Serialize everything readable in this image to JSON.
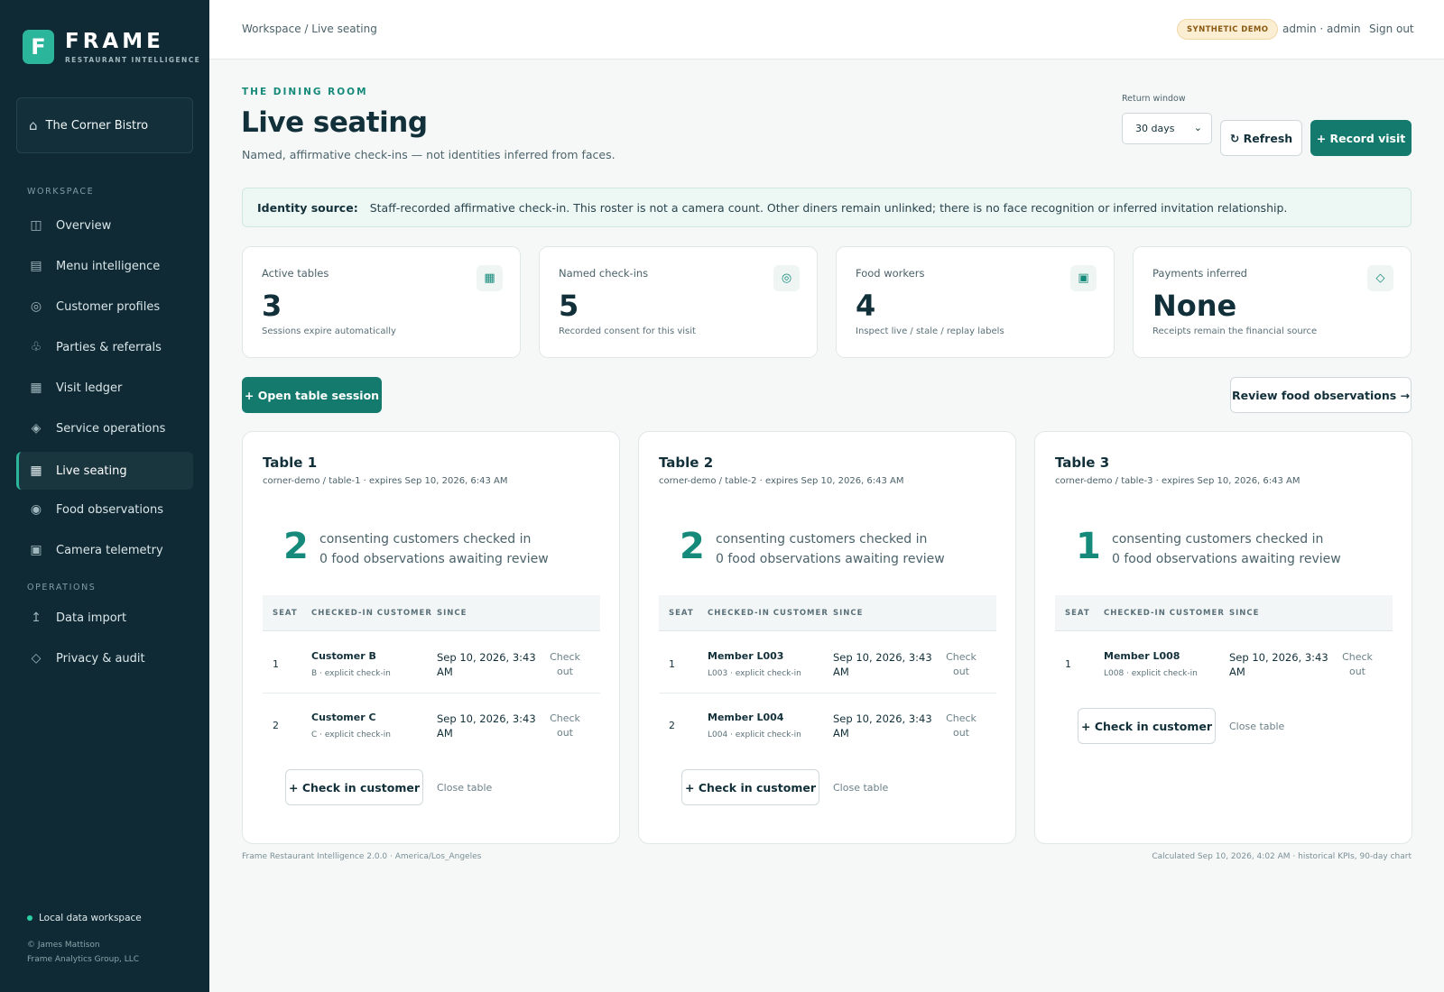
{
  "brand": {
    "mark": "F",
    "name": "FRAME",
    "sub": "RESTAURANT INTELLIGENCE"
  },
  "venue": {
    "icon": "home-icon",
    "name": "The Corner Bistro"
  },
  "nav": {
    "workspace_label": "WORKSPACE",
    "operations_label": "OPERATIONS",
    "items": [
      {
        "label": "Overview",
        "icon": "grid-icon"
      },
      {
        "label": "Menu intelligence",
        "icon": "menu-icon"
      },
      {
        "label": "Customer profiles",
        "icon": "target-icon"
      },
      {
        "label": "Parties & referrals",
        "icon": "club-icon"
      },
      {
        "label": "Visit ledger",
        "icon": "ledger-icon"
      },
      {
        "label": "Service operations",
        "icon": "diamond-icon"
      },
      {
        "label": "Live seating",
        "icon": "seating-icon",
        "active": true
      },
      {
        "label": "Food observations",
        "icon": "eye-icon"
      },
      {
        "label": "Camera telemetry",
        "icon": "camera-icon"
      }
    ],
    "ops_items": [
      {
        "label": "Data import",
        "icon": "upload-icon"
      },
      {
        "label": "Privacy & audit",
        "icon": "shield-icon"
      }
    ]
  },
  "sidebar_footer": {
    "status": "Local data workspace",
    "copyright_line1": "© James Mattison",
    "copyright_line2": "Frame Analytics Group, LLC"
  },
  "topbar": {
    "breadcrumb": "Workspace / Live seating",
    "badge": "SYNTHETIC DEMO",
    "user": "admin · admin",
    "signout": "Sign out"
  },
  "header": {
    "eyebrow": "THE DINING ROOM",
    "title": "Live seating",
    "subtitle": "Named, affirmative check-ins — not identities inferred from faces.",
    "return_window_label": "Return window",
    "return_window_value": "30 days",
    "refresh_label": "↻ Refresh",
    "record_label": "+ Record visit"
  },
  "identity": {
    "label": "Identity source:",
    "text": "Staff-recorded affirmative check-in. This roster is not a camera count. Other diners remain unlinked; there is no face recognition or inferred invitation relationship."
  },
  "kpis": [
    {
      "label": "Active tables",
      "value": "3",
      "note": "Sessions expire automatically",
      "icon": "table-icon"
    },
    {
      "label": "Named check-ins",
      "value": "5",
      "note": "Recorded consent for this visit",
      "icon": "target-icon"
    },
    {
      "label": "Food workers",
      "value": "4",
      "note": "Inspect live / stale / replay labels",
      "icon": "square-icon"
    },
    {
      "label": "Payments inferred",
      "value": "None",
      "note": "Receipts remain the financial source",
      "icon": "diamond-icon"
    }
  ],
  "actions": {
    "open_session": "+ Open table session",
    "review_food": "Review food observations →"
  },
  "table_headers": {
    "seat": "SEAT",
    "customer": "CHECKED-IN CUSTOMER",
    "since": "SINCE"
  },
  "tables": [
    {
      "title": "Table 1",
      "meta": "corner-demo / table-1 · expires Sep 10, 2026, 6:43 AM",
      "count": "2",
      "line1": "consenting customers checked in",
      "line2": "0 food observations awaiting review",
      "rows": [
        {
          "seat": "1",
          "name": "Customer B",
          "sub": "B · explicit check-in",
          "since": "Sep 10, 2026, 3:43 AM",
          "checkout": "Check out"
        },
        {
          "seat": "2",
          "name": "Customer C",
          "sub": "C · explicit check-in",
          "since": "Sep 10, 2026, 3:43 AM",
          "checkout": "Check out"
        }
      ],
      "checkin_label": "+ Check in customer",
      "close_label": "Close table"
    },
    {
      "title": "Table 2",
      "meta": "corner-demo / table-2 · expires Sep 10, 2026, 6:43 AM",
      "count": "2",
      "line1": "consenting customers checked in",
      "line2": "0 food observations awaiting review",
      "rows": [
        {
          "seat": "1",
          "name": "Member L003",
          "sub": "L003 · explicit check-in",
          "since": "Sep 10, 2026, 3:43 AM",
          "checkout": "Check out"
        },
        {
          "seat": "2",
          "name": "Member L004",
          "sub": "L004 · explicit check-in",
          "since": "Sep 10, 2026, 3:43 AM",
          "checkout": "Check out"
        }
      ],
      "checkin_label": "+ Check in customer",
      "close_label": "Close table"
    },
    {
      "title": "Table 3",
      "meta": "corner-demo / table-3 · expires Sep 10, 2026, 6:43 AM",
      "count": "1",
      "line1": "consenting customers checked in",
      "line2": "0 food observations awaiting review",
      "rows": [
        {
          "seat": "1",
          "name": "Member L008",
          "sub": "L008 · explicit check-in",
          "since": "Sep 10, 2026, 3:43 AM",
          "checkout": "Check out"
        }
      ],
      "checkin_label": "+ Check in customer",
      "close_label": "Close table"
    }
  ],
  "footer": {
    "left": "Frame Restaurant Intelligence 2.0.0 · America/Los_Angeles",
    "right": "Calculated Sep 10, 2026, 4:02 AM · historical KPIs, 90-day chart"
  },
  "colors": {
    "sidebar": "#0f2a34",
    "accent": "#137a6d",
    "accent_light": "#2bb59a",
    "badge_bg": "#fbeed3"
  }
}
